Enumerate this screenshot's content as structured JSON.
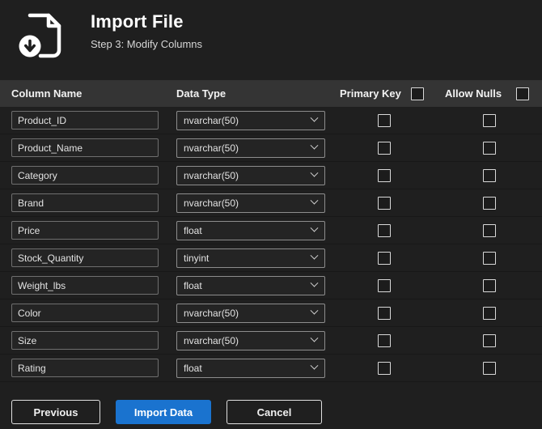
{
  "header": {
    "title": "Import File",
    "subtitle": "Step 3: Modify Columns"
  },
  "table": {
    "headers": {
      "column_name": "Column Name",
      "data_type": "Data Type",
      "primary_key": "Primary Key",
      "allow_nulls": "Allow Nulls"
    },
    "rows": [
      {
        "column_name": "Product_ID",
        "data_type": "nvarchar(50)",
        "primary_key": false,
        "allow_nulls": false
      },
      {
        "column_name": "Product_Name",
        "data_type": "nvarchar(50)",
        "primary_key": false,
        "allow_nulls": false
      },
      {
        "column_name": "Category",
        "data_type": "nvarchar(50)",
        "primary_key": false,
        "allow_nulls": false
      },
      {
        "column_name": "Brand",
        "data_type": "nvarchar(50)",
        "primary_key": false,
        "allow_nulls": false
      },
      {
        "column_name": "Price",
        "data_type": "float",
        "primary_key": false,
        "allow_nulls": false
      },
      {
        "column_name": "Stock_Quantity",
        "data_type": "tinyint",
        "primary_key": false,
        "allow_nulls": false
      },
      {
        "column_name": "Weight_lbs",
        "data_type": "float",
        "primary_key": false,
        "allow_nulls": false
      },
      {
        "column_name": "Color",
        "data_type": "nvarchar(50)",
        "primary_key": false,
        "allow_nulls": false
      },
      {
        "column_name": "Size",
        "data_type": "nvarchar(50)",
        "primary_key": false,
        "allow_nulls": false
      },
      {
        "column_name": "Rating",
        "data_type": "float",
        "primary_key": false,
        "allow_nulls": false
      }
    ]
  },
  "buttons": {
    "previous": "Previous",
    "import": "Import Data",
    "cancel": "Cancel"
  },
  "colors": {
    "background": "#1f1f1f",
    "table_header": "#343434",
    "accent": "#1a73cf",
    "border": "#8d8d8d"
  }
}
